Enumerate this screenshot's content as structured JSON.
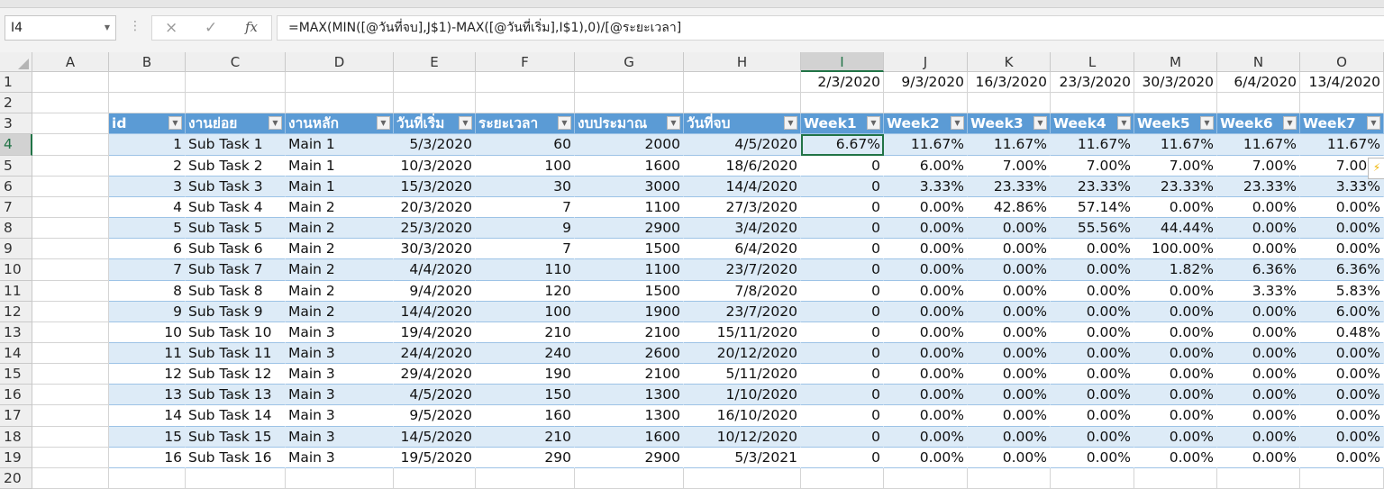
{
  "formula_bar": {
    "name_box": "I4",
    "cancel_icon": "×",
    "enter_icon": "✓",
    "fx_label": "fx",
    "formula": "=MAX(MIN([@วันที่จบ],J$1)-MAX([@วันที่เริ่ม],I$1),0)/[@ระยะเวลา]"
  },
  "columns": [
    "A",
    "B",
    "C",
    "D",
    "E",
    "F",
    "G",
    "H",
    "I",
    "J",
    "K",
    "L",
    "M",
    "N",
    "O"
  ],
  "active_cell": {
    "column": "I",
    "row": 4
  },
  "row1_dates": [
    "2/3/2020",
    "9/3/2020",
    "16/3/2020",
    "23/3/2020",
    "30/3/2020",
    "6/4/2020",
    "13/4/2020"
  ],
  "table": {
    "header_color": "#5b9bd5",
    "band_color": "#ddebf7",
    "headers": [
      "id",
      "งานย่อย",
      "งานหลัก",
      "วันที่เริ่ม",
      "ระยะเวลา",
      "งบประมาณ",
      "วันที่จบ",
      "Week1",
      "Week2",
      "Week3",
      "Week4",
      "Week5",
      "Week6",
      "Week7"
    ],
    "rows": [
      [
        "1",
        "Sub Task 1",
        "Main 1",
        "5/3/2020",
        "60",
        "2000",
        "4/5/2020",
        "6.67%",
        "11.67%",
        "11.67%",
        "11.67%",
        "11.67%",
        "11.67%",
        "11.67%"
      ],
      [
        "2",
        "Sub Task 2",
        "Main 1",
        "10/3/2020",
        "100",
        "1600",
        "18/6/2020",
        "0",
        "6.00%",
        "7.00%",
        "7.00%",
        "7.00%",
        "7.00%",
        "7.00%"
      ],
      [
        "3",
        "Sub Task 3",
        "Main 1",
        "15/3/2020",
        "30",
        "3000",
        "14/4/2020",
        "0",
        "3.33%",
        "23.33%",
        "23.33%",
        "23.33%",
        "23.33%",
        "3.33%"
      ],
      [
        "4",
        "Sub Task 4",
        "Main 2",
        "20/3/2020",
        "7",
        "1100",
        "27/3/2020",
        "0",
        "0.00%",
        "42.86%",
        "57.14%",
        "0.00%",
        "0.00%",
        "0.00%"
      ],
      [
        "5",
        "Sub Task 5",
        "Main 2",
        "25/3/2020",
        "9",
        "2900",
        "3/4/2020",
        "0",
        "0.00%",
        "0.00%",
        "55.56%",
        "44.44%",
        "0.00%",
        "0.00%"
      ],
      [
        "6",
        "Sub Task 6",
        "Main 2",
        "30/3/2020",
        "7",
        "1500",
        "6/4/2020",
        "0",
        "0.00%",
        "0.00%",
        "0.00%",
        "100.00%",
        "0.00%",
        "0.00%"
      ],
      [
        "7",
        "Sub Task 7",
        "Main 2",
        "4/4/2020",
        "110",
        "1100",
        "23/7/2020",
        "0",
        "0.00%",
        "0.00%",
        "0.00%",
        "1.82%",
        "6.36%",
        "6.36%"
      ],
      [
        "8",
        "Sub Task 8",
        "Main 2",
        "9/4/2020",
        "120",
        "1500",
        "7/8/2020",
        "0",
        "0.00%",
        "0.00%",
        "0.00%",
        "0.00%",
        "3.33%",
        "5.83%"
      ],
      [
        "9",
        "Sub Task 9",
        "Main 2",
        "14/4/2020",
        "100",
        "1900",
        "23/7/2020",
        "0",
        "0.00%",
        "0.00%",
        "0.00%",
        "0.00%",
        "0.00%",
        "6.00%"
      ],
      [
        "10",
        "Sub Task 10",
        "Main 3",
        "19/4/2020",
        "210",
        "2100",
        "15/11/2020",
        "0",
        "0.00%",
        "0.00%",
        "0.00%",
        "0.00%",
        "0.00%",
        "0.48%"
      ],
      [
        "11",
        "Sub Task 11",
        "Main 3",
        "24/4/2020",
        "240",
        "2600",
        "20/12/2020",
        "0",
        "0.00%",
        "0.00%",
        "0.00%",
        "0.00%",
        "0.00%",
        "0.00%"
      ],
      [
        "12",
        "Sub Task 12",
        "Main 3",
        "29/4/2020",
        "190",
        "2100",
        "5/11/2020",
        "0",
        "0.00%",
        "0.00%",
        "0.00%",
        "0.00%",
        "0.00%",
        "0.00%"
      ],
      [
        "13",
        "Sub Task 13",
        "Main 3",
        "4/5/2020",
        "150",
        "1300",
        "1/10/2020",
        "0",
        "0.00%",
        "0.00%",
        "0.00%",
        "0.00%",
        "0.00%",
        "0.00%"
      ],
      [
        "14",
        "Sub Task 14",
        "Main 3",
        "9/5/2020",
        "160",
        "1300",
        "16/10/2020",
        "0",
        "0.00%",
        "0.00%",
        "0.00%",
        "0.00%",
        "0.00%",
        "0.00%"
      ],
      [
        "15",
        "Sub Task 15",
        "Main 3",
        "14/5/2020",
        "210",
        "1600",
        "10/12/2020",
        "0",
        "0.00%",
        "0.00%",
        "0.00%",
        "0.00%",
        "0.00%",
        "0.00%"
      ],
      [
        "16",
        "Sub Task 16",
        "Main 3",
        "19/5/2020",
        "290",
        "2900",
        "5/3/2021",
        "0",
        "0.00%",
        "0.00%",
        "0.00%",
        "0.00%",
        "0.00%",
        "0.00%"
      ]
    ]
  },
  "quick_analysis_icon": "⚡"
}
